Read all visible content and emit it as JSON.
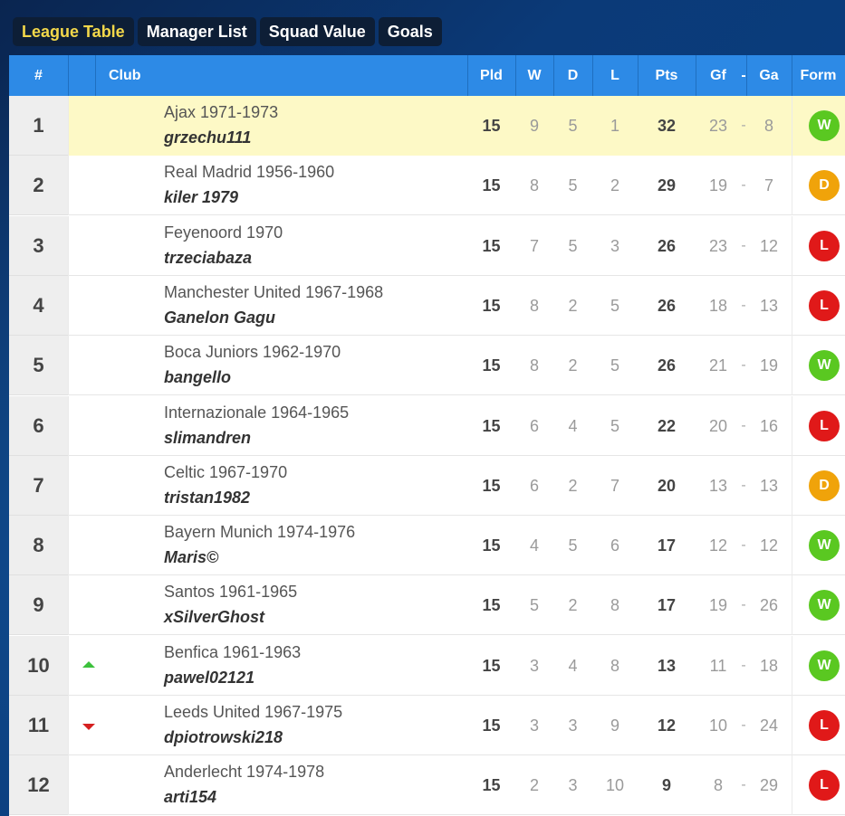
{
  "tabs": [
    {
      "label": "League Table",
      "active": true
    },
    {
      "label": "Manager List",
      "active": false
    },
    {
      "label": "Squad Value",
      "active": false
    },
    {
      "label": "Goals",
      "active": false
    }
  ],
  "header": {
    "pos": "#",
    "club": "Club",
    "pld": "Pld",
    "w": "W",
    "d": "D",
    "l": "L",
    "pts": "Pts",
    "gf": "Gf",
    "dash": "-",
    "ga": "Ga",
    "form": "Form"
  },
  "rows": [
    {
      "pos": "1",
      "club": "Ajax 1971-1973",
      "manager": "grzechu111",
      "pld": "15",
      "w": "9",
      "d": "5",
      "l": "1",
      "pts": "32",
      "gf": "23",
      "ga": "8",
      "form": "W",
      "trend": "none",
      "highlight": true
    },
    {
      "pos": "2",
      "club": "Real Madrid 1956-1960",
      "manager": "kiler 1979",
      "pld": "15",
      "w": "8",
      "d": "5",
      "l": "2",
      "pts": "29",
      "gf": "19",
      "ga": "7",
      "form": "D",
      "trend": "none",
      "highlight": false
    },
    {
      "pos": "3",
      "club": "Feyenoord 1970",
      "manager": "trzeciabaza",
      "pld": "15",
      "w": "7",
      "d": "5",
      "l": "3",
      "pts": "26",
      "gf": "23",
      "ga": "12",
      "form": "L",
      "trend": "none",
      "highlight": false
    },
    {
      "pos": "4",
      "club": "Manchester United 1967-1968",
      "manager": "Ganelon Gagu",
      "pld": "15",
      "w": "8",
      "d": "2",
      "l": "5",
      "pts": "26",
      "gf": "18",
      "ga": "13",
      "form": "L",
      "trend": "none",
      "highlight": false
    },
    {
      "pos": "5",
      "club": "Boca Juniors 1962-1970",
      "manager": "bangello",
      "pld": "15",
      "w": "8",
      "d": "2",
      "l": "5",
      "pts": "26",
      "gf": "21",
      "ga": "19",
      "form": "W",
      "trend": "none",
      "highlight": false
    },
    {
      "pos": "6",
      "club": "Internazionale 1964-1965",
      "manager": "slimandren",
      "pld": "15",
      "w": "6",
      "d": "4",
      "l": "5",
      "pts": "22",
      "gf": "20",
      "ga": "16",
      "form": "L",
      "trend": "none",
      "highlight": false
    },
    {
      "pos": "7",
      "club": "Celtic 1967-1970",
      "manager": "tristan1982",
      "pld": "15",
      "w": "6",
      "d": "2",
      "l": "7",
      "pts": "20",
      "gf": "13",
      "ga": "13",
      "form": "D",
      "trend": "none",
      "highlight": false
    },
    {
      "pos": "8",
      "club": "Bayern Munich 1974-1976",
      "manager": "Maris©",
      "pld": "15",
      "w": "4",
      "d": "5",
      "l": "6",
      "pts": "17",
      "gf": "12",
      "ga": "12",
      "form": "W",
      "trend": "none",
      "highlight": false
    },
    {
      "pos": "9",
      "club": "Santos 1961-1965",
      "manager": "xSilverGhost",
      "pld": "15",
      "w": "5",
      "d": "2",
      "l": "8",
      "pts": "17",
      "gf": "19",
      "ga": "26",
      "form": "W",
      "trend": "none",
      "highlight": false
    },
    {
      "pos": "10",
      "club": "Benfica 1961-1963",
      "manager": "pawel02121",
      "pld": "15",
      "w": "3",
      "d": "4",
      "l": "8",
      "pts": "13",
      "gf": "11",
      "ga": "18",
      "form": "W",
      "trend": "up",
      "highlight": false
    },
    {
      "pos": "11",
      "club": "Leeds United 1967-1975",
      "manager": "dpiotrowski218",
      "pld": "15",
      "w": "3",
      "d": "3",
      "l": "9",
      "pts": "12",
      "gf": "10",
      "ga": "24",
      "form": "L",
      "trend": "down",
      "highlight": false
    },
    {
      "pos": "12",
      "club": "Anderlecht 1974-1978",
      "manager": "arti154",
      "pld": "15",
      "w": "2",
      "d": "3",
      "l": "10",
      "pts": "9",
      "gf": "8",
      "ga": "29",
      "form": "L",
      "trend": "none",
      "highlight": false
    }
  ],
  "colors": {
    "header_bg": "#2d8ae6",
    "active_tab_text": "#f3d84a",
    "highlight_row": "#fdf9c6",
    "form_win": "#5ac821",
    "form_draw": "#f0a30a",
    "form_loss": "#e01919"
  }
}
